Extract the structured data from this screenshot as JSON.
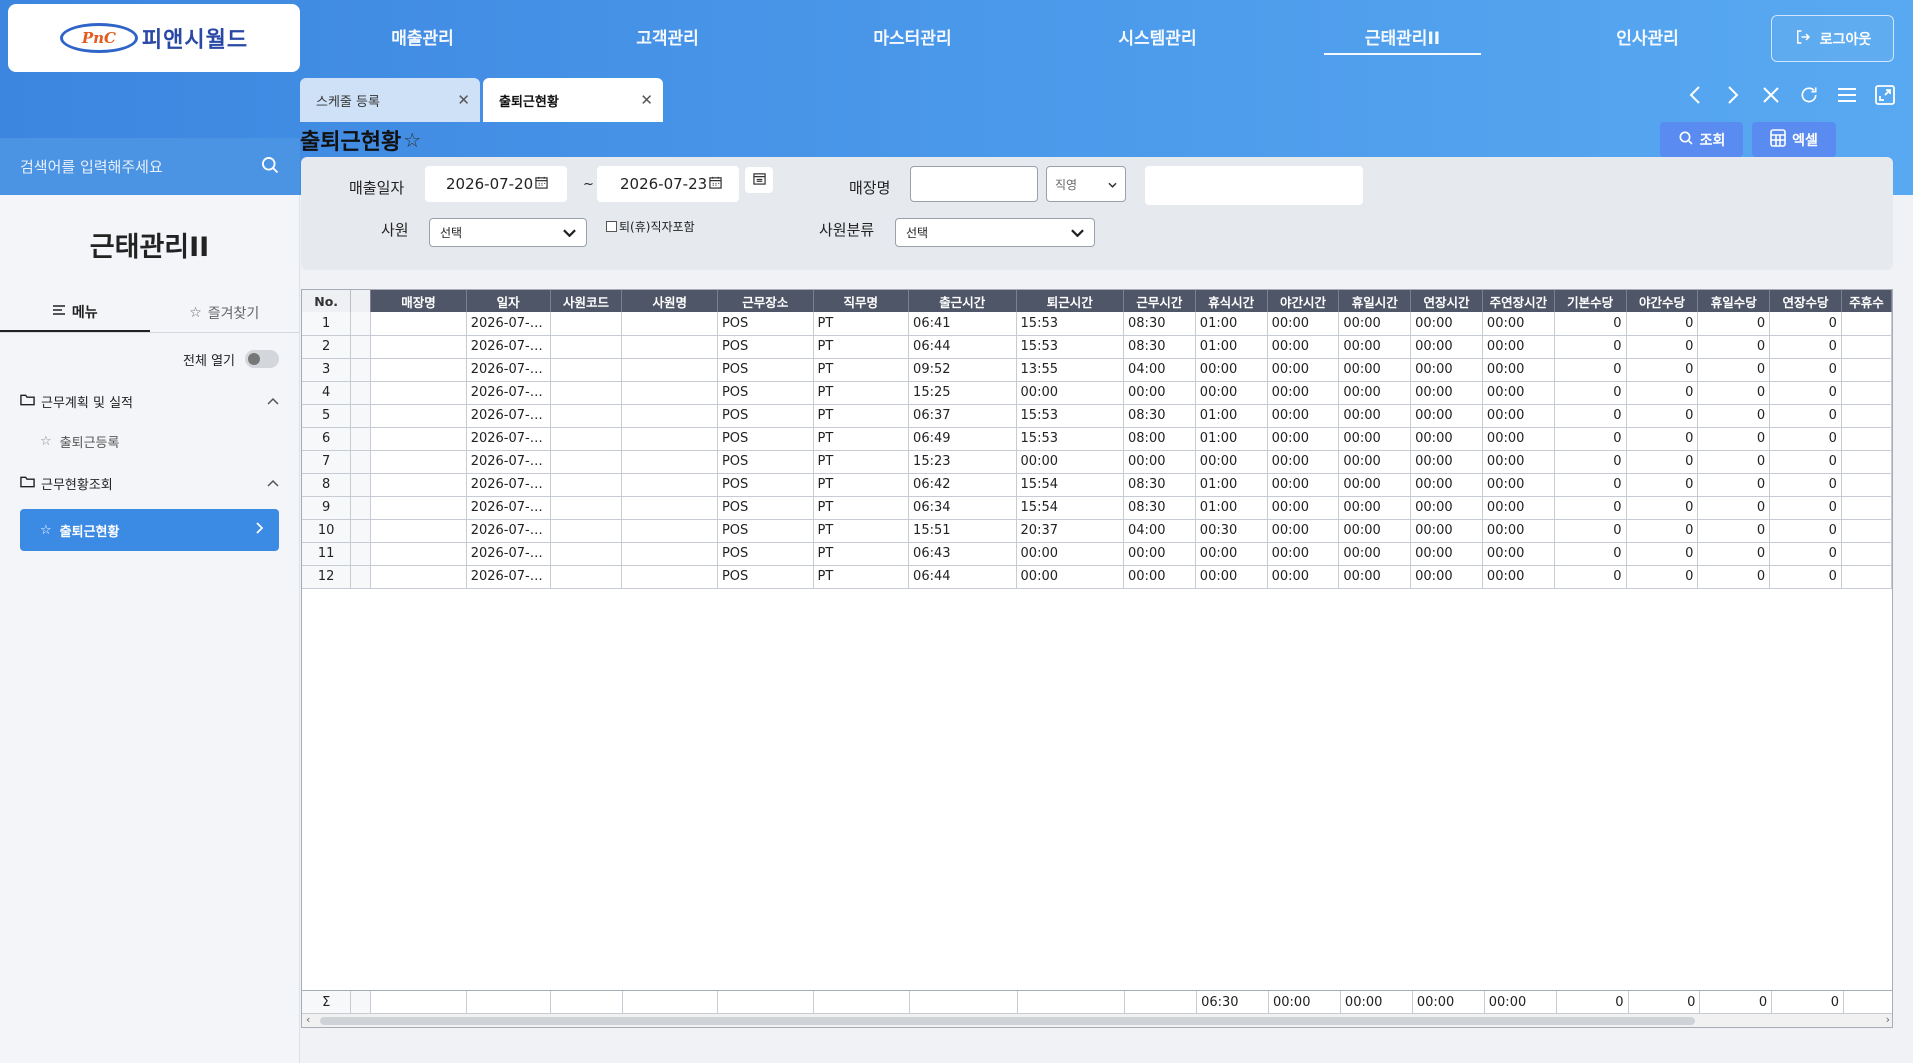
{
  "logo": {
    "mark": "PnC",
    "name": "피앤시월드"
  },
  "nav": {
    "items": [
      "매출관리",
      "고객관리",
      "마스터관리",
      "시스템관리",
      "근태관리II",
      "인사관리"
    ],
    "active_index": 4,
    "logout": "로그아웃"
  },
  "sidebar": {
    "search_placeholder": "검색어를 입력해주세요",
    "title": "근태관리II",
    "tab_menu": "메뉴",
    "tab_fav": "즐겨찾기",
    "expand_all": "전체 열기",
    "group1": "근무계획 및 실적",
    "group1_item": "출퇴근등록",
    "group2": "근무현황조회",
    "group2_item": "출퇴근현황"
  },
  "tabs": {
    "inactive": "스케줄 등록",
    "active": "출퇴근현황"
  },
  "page": {
    "title": "출퇴근현황",
    "search_btn": "조회",
    "excel_btn": "엑셀"
  },
  "filter": {
    "sales_date_label": "매출일자",
    "date_from": "2026-07-20",
    "date_sep": "~",
    "date_to": "2026-07-23",
    "store_label": "매장명",
    "store_select": "직영",
    "employee_label": "사원",
    "employee_select": "선택",
    "retired_label": "퇴(휴)직자포함",
    "emp_class_label": "사원분류",
    "emp_class_select": "선택"
  },
  "grid": {
    "columns": [
      "No.",
      "",
      "매장명",
      "일자",
      "사원코드",
      "사원명",
      "근무장소",
      "직무명",
      "출근시간",
      "퇴근시간",
      "근무시간",
      "휴식시간",
      "야간시간",
      "휴일시간",
      "연장시간",
      "주연장시간",
      "기본수당",
      "야간수당",
      "휴일수당",
      "연장수당",
      "주휴수"
    ],
    "rows": [
      {
        "no": "1",
        "date": "2026-07-…",
        "place": "POS",
        "job": "PT",
        "in": "06:41",
        "out": "15:53",
        "work": "08:30",
        "rest": "01:00",
        "night": "00:00",
        "holiday": "00:00",
        "ext": "00:00",
        "wext": "00:00",
        "base": "0",
        "nightpay": "0",
        "holpay": "0",
        "extpay": "0"
      },
      {
        "no": "2",
        "date": "2026-07-…",
        "place": "POS",
        "job": "PT",
        "in": "06:44",
        "out": "15:53",
        "work": "08:30",
        "rest": "01:00",
        "night": "00:00",
        "holiday": "00:00",
        "ext": "00:00",
        "wext": "00:00",
        "base": "0",
        "nightpay": "0",
        "holpay": "0",
        "extpay": "0"
      },
      {
        "no": "3",
        "date": "2026-07-…",
        "place": "POS",
        "job": "PT",
        "in": "09:52",
        "out": "13:55",
        "work": "04:00",
        "rest": "00:00",
        "night": "00:00",
        "holiday": "00:00",
        "ext": "00:00",
        "wext": "00:00",
        "base": "0",
        "nightpay": "0",
        "holpay": "0",
        "extpay": "0"
      },
      {
        "no": "4",
        "date": "2026-07-…",
        "place": "POS",
        "job": "PT",
        "in": "15:25",
        "out": "00:00",
        "work": "00:00",
        "rest": "00:00",
        "night": "00:00",
        "holiday": "00:00",
        "ext": "00:00",
        "wext": "00:00",
        "base": "0",
        "nightpay": "0",
        "holpay": "0",
        "extpay": "0"
      },
      {
        "no": "5",
        "date": "2026-07-…",
        "place": "POS",
        "job": "PT",
        "in": "06:37",
        "out": "15:53",
        "work": "08:30",
        "rest": "01:00",
        "night": "00:00",
        "holiday": "00:00",
        "ext": "00:00",
        "wext": "00:00",
        "base": "0",
        "nightpay": "0",
        "holpay": "0",
        "extpay": "0"
      },
      {
        "no": "6",
        "date": "2026-07-…",
        "place": "POS",
        "job": "PT",
        "in": "06:49",
        "out": "15:53",
        "work": "08:00",
        "rest": "01:00",
        "night": "00:00",
        "holiday": "00:00",
        "ext": "00:00",
        "wext": "00:00",
        "base": "0",
        "nightpay": "0",
        "holpay": "0",
        "extpay": "0"
      },
      {
        "no": "7",
        "date": "2026-07-…",
        "place": "POS",
        "job": "PT",
        "in": "15:23",
        "out": "00:00",
        "work": "00:00",
        "rest": "00:00",
        "night": "00:00",
        "holiday": "00:00",
        "ext": "00:00",
        "wext": "00:00",
        "base": "0",
        "nightpay": "0",
        "holpay": "0",
        "extpay": "0"
      },
      {
        "no": "8",
        "date": "2026-07-…",
        "place": "POS",
        "job": "PT",
        "in": "06:42",
        "out": "15:54",
        "work": "08:30",
        "rest": "01:00",
        "night": "00:00",
        "holiday": "00:00",
        "ext": "00:00",
        "wext": "00:00",
        "base": "0",
        "nightpay": "0",
        "holpay": "0",
        "extpay": "0"
      },
      {
        "no": "9",
        "date": "2026-07-…",
        "place": "POS",
        "job": "PT",
        "in": "06:34",
        "out": "15:54",
        "work": "08:30",
        "rest": "01:00",
        "night": "00:00",
        "holiday": "00:00",
        "ext": "00:00",
        "wext": "00:00",
        "base": "0",
        "nightpay": "0",
        "holpay": "0",
        "extpay": "0"
      },
      {
        "no": "10",
        "date": "2026-07-…",
        "place": "POS",
        "job": "PT",
        "in": "15:51",
        "out": "20:37",
        "work": "04:00",
        "rest": "00:30",
        "night": "00:00",
        "holiday": "00:00",
        "ext": "00:00",
        "wext": "00:00",
        "base": "0",
        "nightpay": "0",
        "holpay": "0",
        "extpay": "0"
      },
      {
        "no": "11",
        "date": "2026-07-…",
        "place": "POS",
        "job": "PT",
        "in": "06:43",
        "out": "00:00",
        "work": "00:00",
        "rest": "00:00",
        "night": "00:00",
        "holiday": "00:00",
        "ext": "00:00",
        "wext": "00:00",
        "base": "0",
        "nightpay": "0",
        "holpay": "0",
        "extpay": "0"
      },
      {
        "no": "12",
        "date": "2026-07-…",
        "place": "POS",
        "job": "PT",
        "in": "06:44",
        "out": "00:00",
        "work": "00:00",
        "rest": "00:00",
        "night": "00:00",
        "holiday": "00:00",
        "ext": "00:00",
        "wext": "00:00",
        "base": "0",
        "nightpay": "0",
        "holpay": "0",
        "extpay": "0"
      }
    ],
    "summary": {
      "sigma": "Σ",
      "rest": "06:30",
      "night": "00:00",
      "holiday": "00:00",
      "ext": "00:00",
      "wext": "00:00",
      "base": "0",
      "nightpay": "0",
      "holpay": "0",
      "extpay": "0"
    }
  },
  "colors": {
    "accent": "#3b8ae4",
    "header_dark": "#4f5668",
    "button": "#5a8bf0"
  }
}
